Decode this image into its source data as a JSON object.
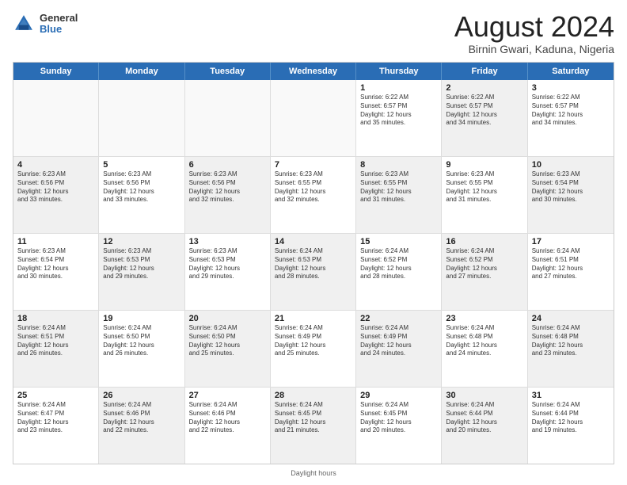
{
  "header": {
    "logo": {
      "general": "General",
      "blue": "Blue"
    },
    "title": "August 2024",
    "location": "Birnin Gwari, Kaduna, Nigeria"
  },
  "calendar": {
    "weekdays": [
      "Sunday",
      "Monday",
      "Tuesday",
      "Wednesday",
      "Thursday",
      "Friday",
      "Saturday"
    ],
    "weeks": [
      [
        {
          "day": "",
          "info": "",
          "empty": true
        },
        {
          "day": "",
          "info": "",
          "empty": true
        },
        {
          "day": "",
          "info": "",
          "empty": true
        },
        {
          "day": "",
          "info": "",
          "empty": true
        },
        {
          "day": "1",
          "info": "Sunrise: 6:22 AM\nSunset: 6:57 PM\nDaylight: 12 hours\nand 35 minutes."
        },
        {
          "day": "2",
          "info": "Sunrise: 6:22 AM\nSunset: 6:57 PM\nDaylight: 12 hours\nand 34 minutes.",
          "shaded": true
        },
        {
          "day": "3",
          "info": "Sunrise: 6:22 AM\nSunset: 6:57 PM\nDaylight: 12 hours\nand 34 minutes."
        }
      ],
      [
        {
          "day": "4",
          "info": "Sunrise: 6:23 AM\nSunset: 6:56 PM\nDaylight: 12 hours\nand 33 minutes.",
          "shaded": true
        },
        {
          "day": "5",
          "info": "Sunrise: 6:23 AM\nSunset: 6:56 PM\nDaylight: 12 hours\nand 33 minutes."
        },
        {
          "day": "6",
          "info": "Sunrise: 6:23 AM\nSunset: 6:56 PM\nDaylight: 12 hours\nand 32 minutes.",
          "shaded": true
        },
        {
          "day": "7",
          "info": "Sunrise: 6:23 AM\nSunset: 6:55 PM\nDaylight: 12 hours\nand 32 minutes."
        },
        {
          "day": "8",
          "info": "Sunrise: 6:23 AM\nSunset: 6:55 PM\nDaylight: 12 hours\nand 31 minutes.",
          "shaded": true
        },
        {
          "day": "9",
          "info": "Sunrise: 6:23 AM\nSunset: 6:55 PM\nDaylight: 12 hours\nand 31 minutes."
        },
        {
          "day": "10",
          "info": "Sunrise: 6:23 AM\nSunset: 6:54 PM\nDaylight: 12 hours\nand 30 minutes.",
          "shaded": true
        }
      ],
      [
        {
          "day": "11",
          "info": "Sunrise: 6:23 AM\nSunset: 6:54 PM\nDaylight: 12 hours\nand 30 minutes."
        },
        {
          "day": "12",
          "info": "Sunrise: 6:23 AM\nSunset: 6:53 PM\nDaylight: 12 hours\nand 29 minutes.",
          "shaded": true
        },
        {
          "day": "13",
          "info": "Sunrise: 6:23 AM\nSunset: 6:53 PM\nDaylight: 12 hours\nand 29 minutes."
        },
        {
          "day": "14",
          "info": "Sunrise: 6:24 AM\nSunset: 6:53 PM\nDaylight: 12 hours\nand 28 minutes.",
          "shaded": true
        },
        {
          "day": "15",
          "info": "Sunrise: 6:24 AM\nSunset: 6:52 PM\nDaylight: 12 hours\nand 28 minutes."
        },
        {
          "day": "16",
          "info": "Sunrise: 6:24 AM\nSunset: 6:52 PM\nDaylight: 12 hours\nand 27 minutes.",
          "shaded": true
        },
        {
          "day": "17",
          "info": "Sunrise: 6:24 AM\nSunset: 6:51 PM\nDaylight: 12 hours\nand 27 minutes."
        }
      ],
      [
        {
          "day": "18",
          "info": "Sunrise: 6:24 AM\nSunset: 6:51 PM\nDaylight: 12 hours\nand 26 minutes.",
          "shaded": true
        },
        {
          "day": "19",
          "info": "Sunrise: 6:24 AM\nSunset: 6:50 PM\nDaylight: 12 hours\nand 26 minutes."
        },
        {
          "day": "20",
          "info": "Sunrise: 6:24 AM\nSunset: 6:50 PM\nDaylight: 12 hours\nand 25 minutes.",
          "shaded": true
        },
        {
          "day": "21",
          "info": "Sunrise: 6:24 AM\nSunset: 6:49 PM\nDaylight: 12 hours\nand 25 minutes."
        },
        {
          "day": "22",
          "info": "Sunrise: 6:24 AM\nSunset: 6:49 PM\nDaylight: 12 hours\nand 24 minutes.",
          "shaded": true
        },
        {
          "day": "23",
          "info": "Sunrise: 6:24 AM\nSunset: 6:48 PM\nDaylight: 12 hours\nand 24 minutes."
        },
        {
          "day": "24",
          "info": "Sunrise: 6:24 AM\nSunset: 6:48 PM\nDaylight: 12 hours\nand 23 minutes.",
          "shaded": true
        }
      ],
      [
        {
          "day": "25",
          "info": "Sunrise: 6:24 AM\nSunset: 6:47 PM\nDaylight: 12 hours\nand 23 minutes."
        },
        {
          "day": "26",
          "info": "Sunrise: 6:24 AM\nSunset: 6:46 PM\nDaylight: 12 hours\nand 22 minutes.",
          "shaded": true
        },
        {
          "day": "27",
          "info": "Sunrise: 6:24 AM\nSunset: 6:46 PM\nDaylight: 12 hours\nand 22 minutes."
        },
        {
          "day": "28",
          "info": "Sunrise: 6:24 AM\nSunset: 6:45 PM\nDaylight: 12 hours\nand 21 minutes.",
          "shaded": true
        },
        {
          "day": "29",
          "info": "Sunrise: 6:24 AM\nSunset: 6:45 PM\nDaylight: 12 hours\nand 20 minutes."
        },
        {
          "day": "30",
          "info": "Sunrise: 6:24 AM\nSunset: 6:44 PM\nDaylight: 12 hours\nand 20 minutes.",
          "shaded": true
        },
        {
          "day": "31",
          "info": "Sunrise: 6:24 AM\nSunset: 6:44 PM\nDaylight: 12 hours\nand 19 minutes."
        }
      ]
    ]
  },
  "footer": {
    "text": "Daylight hours"
  }
}
